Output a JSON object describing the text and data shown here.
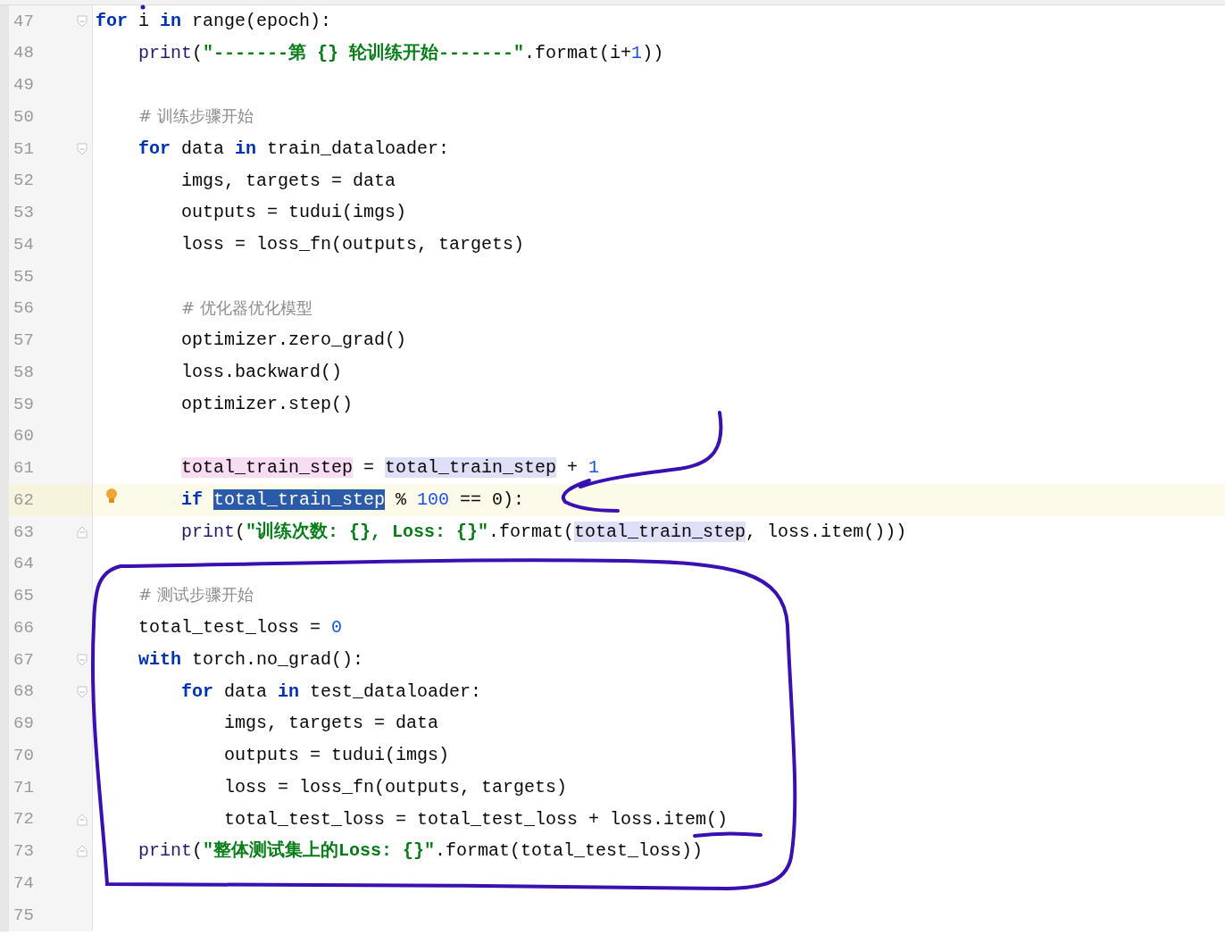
{
  "editor": {
    "lines": [
      {
        "number": "47",
        "current": false,
        "kind": "fold-start",
        "tokens": [
          {
            "text": "for",
            "kind": "kw"
          },
          {
            "text": " i ",
            "kind": "plain"
          },
          {
            "text": "in",
            "kind": "kw"
          },
          {
            "text": " range(epoch):",
            "kind": "plain"
          }
        ],
        "children": [
          {
            "number": "48",
            "current": false,
            "kind": "code",
            "tokens": [
              {
                "text": "print",
                "kind": "builtin"
              },
              {
                "text": "(",
                "kind": "plain"
              },
              {
                "text": "\"-------第 {} 轮训练开始-------\"",
                "kind": "str"
              },
              {
                "text": ".format(i+",
                "kind": "plain"
              },
              {
                "text": "1",
                "kind": "num"
              },
              {
                "text": "))",
                "kind": "plain"
              }
            ]
          },
          {
            "number": "49",
            "current": false,
            "kind": "blank"
          },
          {
            "number": "50",
            "current": false,
            "kind": "code",
            "tokens": [
              {
                "text": "# 训练步骤开始",
                "kind": "cmt"
              }
            ]
          },
          {
            "number": "51",
            "current": false,
            "kind": "fold-start",
            "tokens": [
              {
                "text": "for",
                "kind": "kw"
              },
              {
                "text": " data ",
                "kind": "plain"
              },
              {
                "text": "in",
                "kind": "kw"
              },
              {
                "text": " train_dataloader:",
                "kind": "plain"
              }
            ],
            "children": [
              {
                "number": "52",
                "current": false,
                "kind": "code",
                "tokens": [
                  {
                    "text": "imgs, targets = data",
                    "kind": "plain"
                  }
                ]
              },
              {
                "number": "53",
                "current": false,
                "kind": "code",
                "tokens": [
                  {
                    "text": "outputs = tudui(imgs)",
                    "kind": "plain"
                  }
                ]
              },
              {
                "number": "54",
                "current": false,
                "kind": "code",
                "tokens": [
                  {
                    "text": "loss = loss_fn(outputs, targets)",
                    "kind": "plain"
                  }
                ]
              },
              {
                "number": "55",
                "current": false,
                "kind": "blank"
              },
              {
                "number": "56",
                "current": false,
                "kind": "code",
                "tokens": [
                  {
                    "text": "# 优化器优化模型",
                    "kind": "cmt"
                  }
                ]
              },
              {
                "number": "57",
                "current": false,
                "kind": "code",
                "tokens": [
                  {
                    "text": "optimizer.zero_grad()",
                    "kind": "plain"
                  }
                ]
              },
              {
                "number": "58",
                "current": false,
                "kind": "code",
                "tokens": [
                  {
                    "text": "loss.backward()",
                    "kind": "plain"
                  }
                ]
              },
              {
                "number": "59",
                "current": false,
                "kind": "code",
                "tokens": [
                  {
                    "text": "optimizer.step()",
                    "kind": "plain"
                  }
                ]
              },
              {
                "number": "60",
                "current": false,
                "kind": "blank"
              },
              {
                "number": "61",
                "current": false,
                "kind": "code",
                "tokens": [
                  {
                    "text": "total_train_step",
                    "kind": "var-write"
                  },
                  {
                    "text": " = ",
                    "kind": "plain"
                  },
                  {
                    "text": "total_train_step",
                    "kind": "var-read"
                  },
                  {
                    "text": " + ",
                    "kind": "plain"
                  },
                  {
                    "text": "1",
                    "kind": "num"
                  }
                ]
              },
              {
                "number": "62",
                "current": true,
                "bulb": true,
                "kind": "code",
                "tokens": [
                  {
                    "text": "if ",
                    "kind": "kw"
                  },
                  {
                    "text": "total_train_step",
                    "kind": "var-selected"
                  },
                  {
                    "text": " % ",
                    "kind": "plain"
                  },
                  {
                    "text": "100",
                    "kind": "num"
                  },
                  {
                    "text": " == ",
                    "kind": "plain"
                  },
                  {
                    "text": "0",
                    "kind": "plain"
                  },
                  {
                    "text": "):",
                    "kind": "plain"
                  }
                ]
              },
              {
                "number": "63",
                "current": false,
                "kind": "fold-end",
                "tokens": [
                  {
                    "text": "print",
                    "kind": "builtin"
                  },
                  {
                    "text": "(",
                    "kind": "plain"
                  },
                  {
                    "text": "\"训练次数: {}, Loss: {}\"",
                    "kind": "str"
                  },
                  {
                    "text": ".format(",
                    "kind": "plain"
                  },
                  {
                    "text": "total_train_step",
                    "kind": "var-read"
                  },
                  {
                    "text": ", loss.item()))",
                    "kind": "plain"
                  }
                ]
              }
            ]
          },
          {
            "number": "64",
            "current": false,
            "kind": "blank"
          },
          {
            "number": "65",
            "current": false,
            "kind": "code",
            "tokens": [
              {
                "text": "# 测试步骤开始",
                "kind": "cmt"
              }
            ]
          },
          {
            "number": "66",
            "current": false,
            "kind": "code",
            "tokens": [
              {
                "text": "total_test_loss = ",
                "kind": "plain"
              },
              {
                "text": "0",
                "kind": "num"
              }
            ]
          },
          {
            "number": "67",
            "current": false,
            "kind": "fold-start",
            "tokens": [
              {
                "text": "with",
                "kind": "kw"
              },
              {
                "text": " torch.no_grad():",
                "kind": "plain"
              }
            ],
            "children": [
              {
                "number": "68",
                "current": false,
                "kind": "fold-start",
                "tokens": [
                  {
                    "text": "for",
                    "kind": "kw"
                  },
                  {
                    "text": " data ",
                    "kind": "plain"
                  },
                  {
                    "text": "in",
                    "kind": "kw"
                  },
                  {
                    "text": " test_dataloader:",
                    "kind": "plain"
                  }
                ],
                "children": [
                  {
                    "number": "69",
                    "current": false,
                    "kind": "code",
                    "tokens": [
                      {
                        "text": "imgs, targets = data",
                        "kind": "plain"
                      }
                    ]
                  },
                  {
                    "number": "70",
                    "current": false,
                    "kind": "code",
                    "tokens": [
                      {
                        "text": "outputs = tudui(imgs)",
                        "kind": "plain"
                      }
                    ]
                  },
                  {
                    "number": "71",
                    "current": false,
                    "kind": "code",
                    "tokens": [
                      {
                        "text": "loss = loss_fn(outputs, targets)",
                        "kind": "plain"
                      }
                    ]
                  },
                  {
                    "number": "72",
                    "current": false,
                    "kind": "fold-end",
                    "tokens": [
                      {
                        "text": "total_test_loss = total_test_loss + loss.item()",
                        "kind": "plain"
                      }
                    ]
                  }
                ]
              }
            ]
          },
          {
            "number": "73",
            "current": false,
            "kind": "fold-end",
            "tokens": [
              {
                "text": "print",
                "kind": "builtin"
              },
              {
                "text": "(",
                "kind": "plain"
              },
              {
                "text": "\"整体测试集上的Loss: {}\"",
                "kind": "str"
              },
              {
                "text": ".format(total_test_loss))",
                "kind": "plain"
              }
            ]
          },
          {
            "number": "74",
            "current": false,
            "kind": "blank"
          },
          {
            "number": "75",
            "current": false,
            "kind": "blank"
          }
        ]
      }
    ]
  }
}
